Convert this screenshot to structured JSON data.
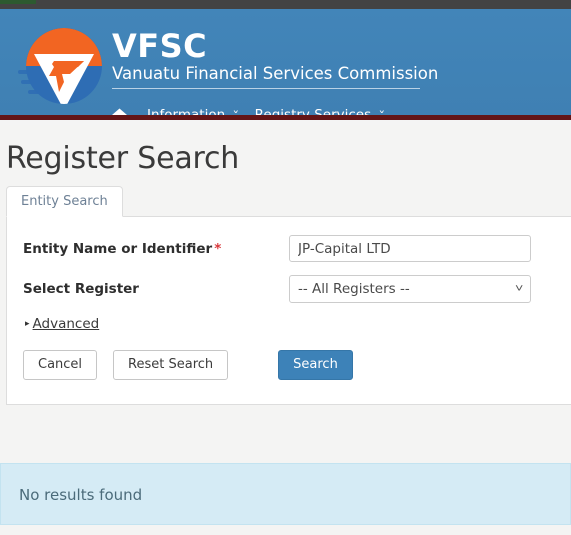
{
  "brand": {
    "acronym": "VFSC",
    "full_name": "Vanuatu Financial Services Commission",
    "logo_icon": "vfsc-shield-logo",
    "colors": {
      "header_blue": "#4084b8",
      "header_underline_red": "#631517",
      "logo_orange": "#f26522",
      "logo_blue": "#2e6db4",
      "primary_button": "#3d82b8",
      "required_star": "#d9393c",
      "info_panel": "#d5ebf5"
    }
  },
  "nav": {
    "home_icon": "home-icon",
    "items": [
      {
        "label": "Information",
        "caret": "˅"
      },
      {
        "label": "Registry Services",
        "caret": "˅"
      }
    ]
  },
  "page": {
    "title": "Register Search"
  },
  "tabs": [
    {
      "label": "Entity Search",
      "active": true
    }
  ],
  "form": {
    "entity_name": {
      "label": "Entity Name or Identifier",
      "required_marker": "*",
      "value": "JP-Capital LTD",
      "placeholder": ""
    },
    "select_register": {
      "label": "Select Register",
      "selected": "-- All Registers --",
      "options": [
        "-- All Registers --"
      ],
      "caret": "˅"
    },
    "advanced": {
      "label": "Advanced",
      "arrow": "▸"
    },
    "buttons": {
      "cancel": "Cancel",
      "reset": "Reset Search",
      "search": "Search"
    }
  },
  "results": {
    "message": "No results found"
  }
}
